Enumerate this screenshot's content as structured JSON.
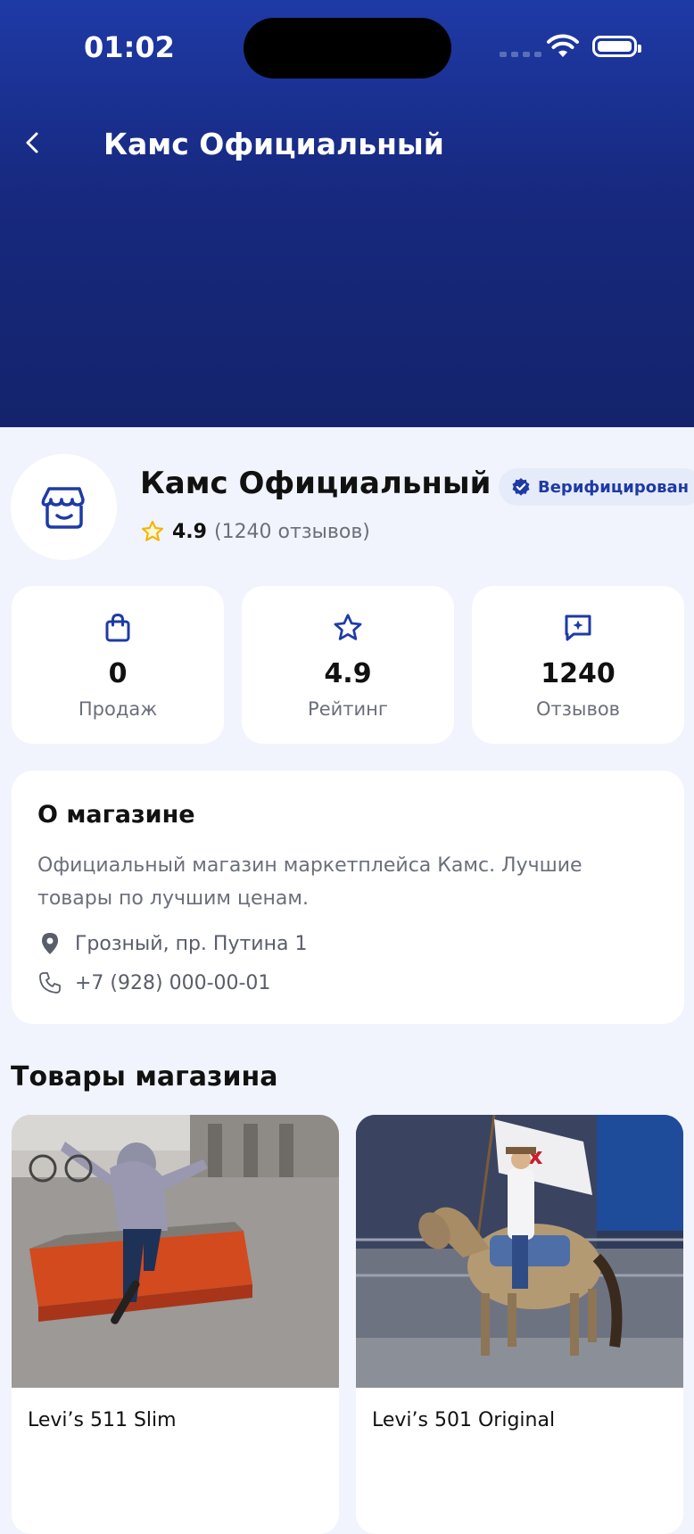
{
  "status_bar": {
    "time": "01:02"
  },
  "header": {
    "title": "Камс Официальный"
  },
  "store": {
    "name": "Камс Официальный",
    "verified_label": "Верифицирован",
    "rating": "4.9",
    "reviews_text": "(1240 отзывов)"
  },
  "stats": [
    {
      "value": "0",
      "label": "Продаж",
      "icon": "shopping-bag-icon"
    },
    {
      "value": "4.9",
      "label": "Рейтинг",
      "icon": "star-icon"
    },
    {
      "value": "1240",
      "label": "Отзывов",
      "icon": "chat-star-icon"
    }
  ],
  "about": {
    "title": "О магазине",
    "description": "Официальный магазин маркетплейса Камс. Лучшие товары по лучшим ценам.",
    "address": "Грозный, пр. Путина 1",
    "phone": "+7 (928) 000-00-01"
  },
  "products_section": {
    "title": "Товары магазина",
    "items": [
      {
        "name": "Levi’s 511 Slim"
      },
      {
        "name": "Levi’s 501 Original"
      }
    ]
  },
  "colors": {
    "brand": "#1E3AA6",
    "hero_dark": "#14236B",
    "background": "#F1F4FC",
    "star": "#F5B400"
  }
}
